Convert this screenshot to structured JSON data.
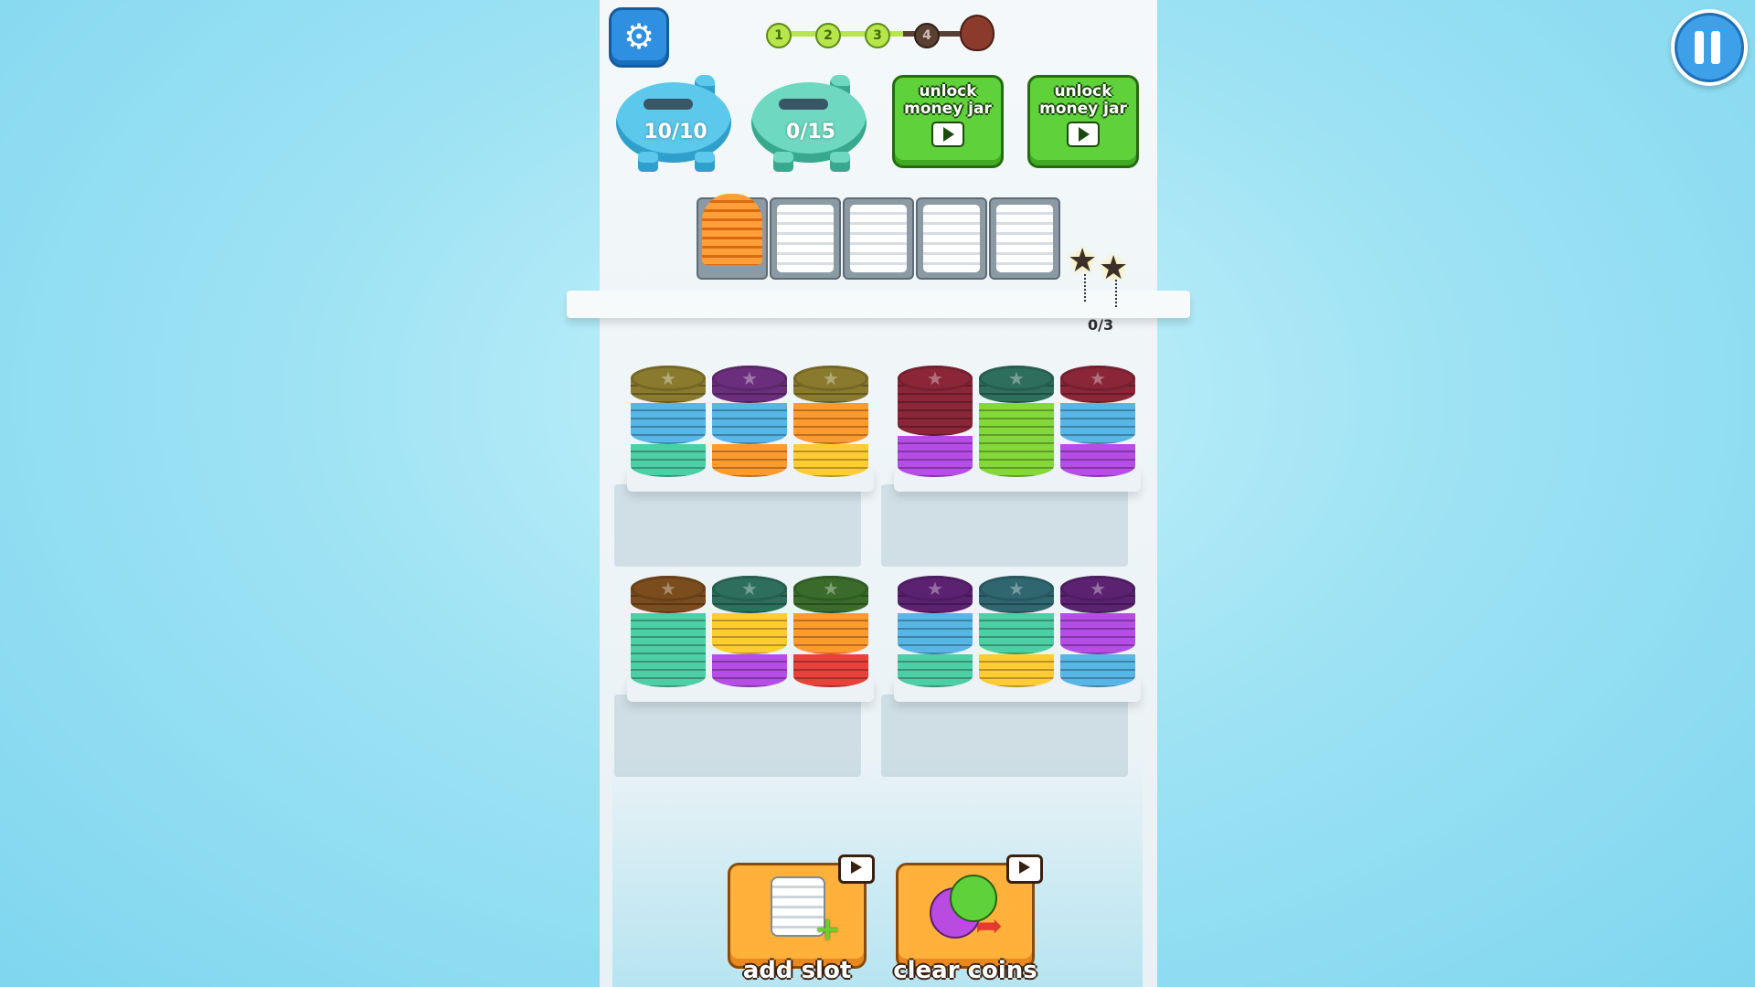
{
  "hud": {
    "progress_steps": [
      {
        "label": "1",
        "state": "done"
      },
      {
        "label": "2",
        "state": "done"
      },
      {
        "label": "3",
        "state": "done"
      },
      {
        "label": "4",
        "state": "todo"
      }
    ],
    "boss_icon": "demon-head-icon",
    "settings_icon": "gear-icon",
    "pause_icon": "pause-icon"
  },
  "piggy_banks": [
    {
      "count": "10/10",
      "color": "#5cc8ec",
      "color_dark": "#2f9fcb"
    },
    {
      "count": "0/15",
      "color": "#6fd8c0",
      "color_dark": "#38a88f"
    }
  ],
  "unlock_jars": [
    {
      "label": "unlock money jar"
    },
    {
      "label": "unlock money jar"
    }
  ],
  "slots": [
    {
      "filled": true,
      "coin_color": "#ff9f3a",
      "fill_fraction": 0.95
    },
    {
      "filled": false
    },
    {
      "filled": false
    },
    {
      "filled": false
    },
    {
      "filled": false
    }
  ],
  "star_counter": "0/3",
  "colors": {
    "olive": "#8a7a2e",
    "purple_dark": "#6b2e7d",
    "wine": "#8a2638",
    "teal_dark": "#2e6e5c",
    "brown": "#7a4c1e",
    "forest": "#3a6b2a",
    "plum": "#5c2272",
    "slate_teal": "#2f6670",
    "sky": "#58b6e6",
    "mint": "#4ccfa4",
    "orange": "#ff9a2e",
    "yellow": "#ffcc33",
    "violet": "#b64de6",
    "green": "#84d83a",
    "red": "#e8413a"
  },
  "trays": [
    {
      "stacks": [
        [
          {
            "c": "mint",
            "n": 4
          },
          {
            "c": "sky",
            "n": 5
          },
          {
            "c": "olive",
            "n": 3
          }
        ],
        [
          {
            "c": "orange",
            "n": 4
          },
          {
            "c": "sky",
            "n": 5
          },
          {
            "c": "purple_dark",
            "n": 3
          }
        ],
        [
          {
            "c": "yellow",
            "n": 4
          },
          {
            "c": "orange",
            "n": 5
          },
          {
            "c": "olive",
            "n": 3
          }
        ]
      ]
    },
    {
      "stacks": [
        [
          {
            "c": "violet",
            "n": 5
          },
          {
            "c": "wine",
            "n": 7
          }
        ],
        [
          {
            "c": "green",
            "n": 9
          },
          {
            "c": "teal_dark",
            "n": 3
          }
        ],
        [
          {
            "c": "violet",
            "n": 4
          },
          {
            "c": "sky",
            "n": 5
          },
          {
            "c": "wine",
            "n": 3
          }
        ]
      ]
    },
    {
      "stacks": [
        [
          {
            "c": "mint",
            "n": 9
          },
          {
            "c": "brown",
            "n": 3
          }
        ],
        [
          {
            "c": "violet",
            "n": 4
          },
          {
            "c": "yellow",
            "n": 5
          },
          {
            "c": "teal_dark",
            "n": 3
          }
        ],
        [
          {
            "c": "red",
            "n": 4
          },
          {
            "c": "orange",
            "n": 5
          },
          {
            "c": "forest",
            "n": 3
          }
        ]
      ]
    },
    {
      "stacks": [
        [
          {
            "c": "mint",
            "n": 4
          },
          {
            "c": "sky",
            "n": 5
          },
          {
            "c": "plum",
            "n": 3
          }
        ],
        [
          {
            "c": "yellow",
            "n": 4
          },
          {
            "c": "mint",
            "n": 5
          },
          {
            "c": "slate_teal",
            "n": 3
          }
        ],
        [
          {
            "c": "sky",
            "n": 4
          },
          {
            "c": "violet",
            "n": 5
          },
          {
            "c": "plum",
            "n": 3
          }
        ]
      ]
    }
  ],
  "tools": [
    {
      "label": "add slot",
      "icon": "cup-plus-icon",
      "badge": "video-icon"
    },
    {
      "label": "clear coins",
      "icon": "coins-arrow-icon",
      "badge": "video-icon"
    }
  ]
}
